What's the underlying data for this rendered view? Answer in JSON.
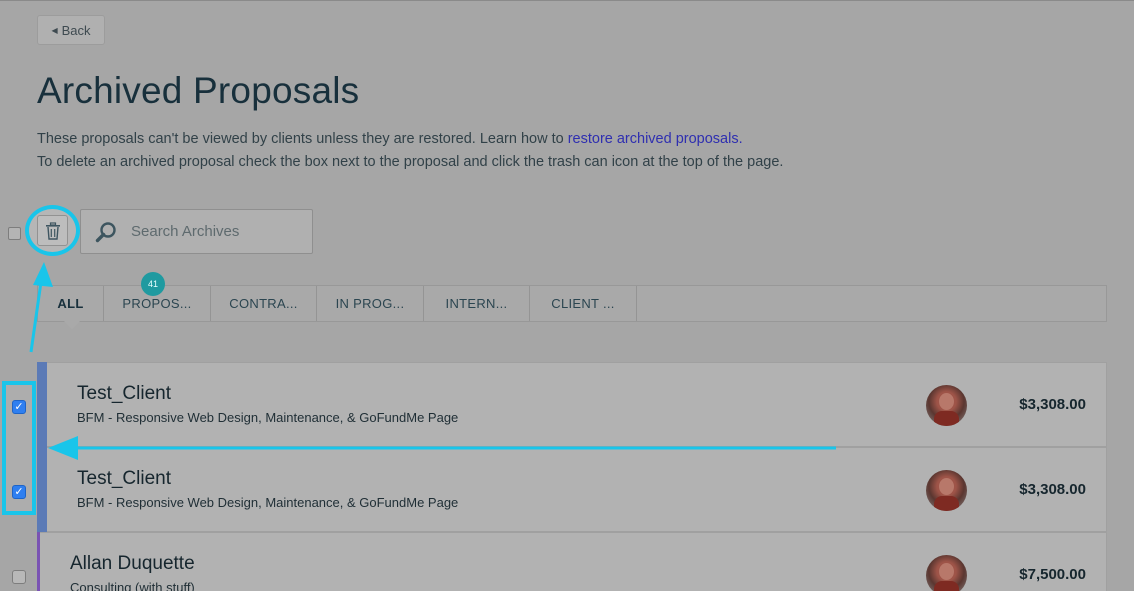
{
  "nav": {
    "back_label": "Back"
  },
  "page": {
    "title": "Archived Proposals",
    "desc_line1_prefix": "These proposals can't be viewed by clients unless they are restored. Learn how to ",
    "desc_link": "restore archived proposals.",
    "desc_line2": "To delete an archived proposal check the box next to the proposal and click the trash can icon at the top of the page."
  },
  "toolbar": {
    "search_placeholder": "Search Archives",
    "trash_icon": "trash-icon",
    "search_icon": "magnifier-icon"
  },
  "tabs": [
    {
      "label": "ALL",
      "active": true
    },
    {
      "label": "PROPOS...",
      "badge": "41"
    },
    {
      "label": "CONTRA..."
    },
    {
      "label": "IN PROG..."
    },
    {
      "label": "INTERN..."
    },
    {
      "label": "CLIENT ..."
    }
  ],
  "proposals": [
    {
      "client": "Test_Client",
      "project": "BFM - Responsive Web Design, Maintenance, & GoFundMe Page",
      "amount": "$3,308.00",
      "checked": true
    },
    {
      "client": "Test_Client",
      "project": "BFM - Responsive Web Design, Maintenance, & GoFundMe Page",
      "amount": "$3,308.00",
      "checked": true
    },
    {
      "client": "Allan Duquette",
      "project": "Consulting (with stuff)",
      "amount": "$7,500.00",
      "checked": false
    }
  ],
  "colors": {
    "highlight": "#19c5ea",
    "badge": "#1f9aa0",
    "card_accent_blue": "#5b7ab6",
    "card_accent_purple": "#7a53b3",
    "link": "#2f2fb0"
  }
}
